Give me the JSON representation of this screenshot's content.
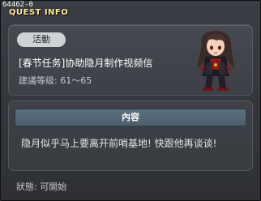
{
  "window": {
    "id_label": "64462-0",
    "title": "QUEST INFO",
    "close_glyph": "✕"
  },
  "quest": {
    "category_tag": "活動",
    "title": "[春节任务]协助隐月制作视频信",
    "level": "建議等级: 61～65"
  },
  "npc": {
    "icon": "npc-portrait-icon"
  },
  "content": {
    "header": "內容",
    "text": "隐月似乎马上要离开前哨基地! 快跟他再谈谈!"
  },
  "status": {
    "text": "狀態: 可開始"
  },
  "colors": {
    "title_accent": "#ffe79a",
    "content_header": "#56687a"
  }
}
